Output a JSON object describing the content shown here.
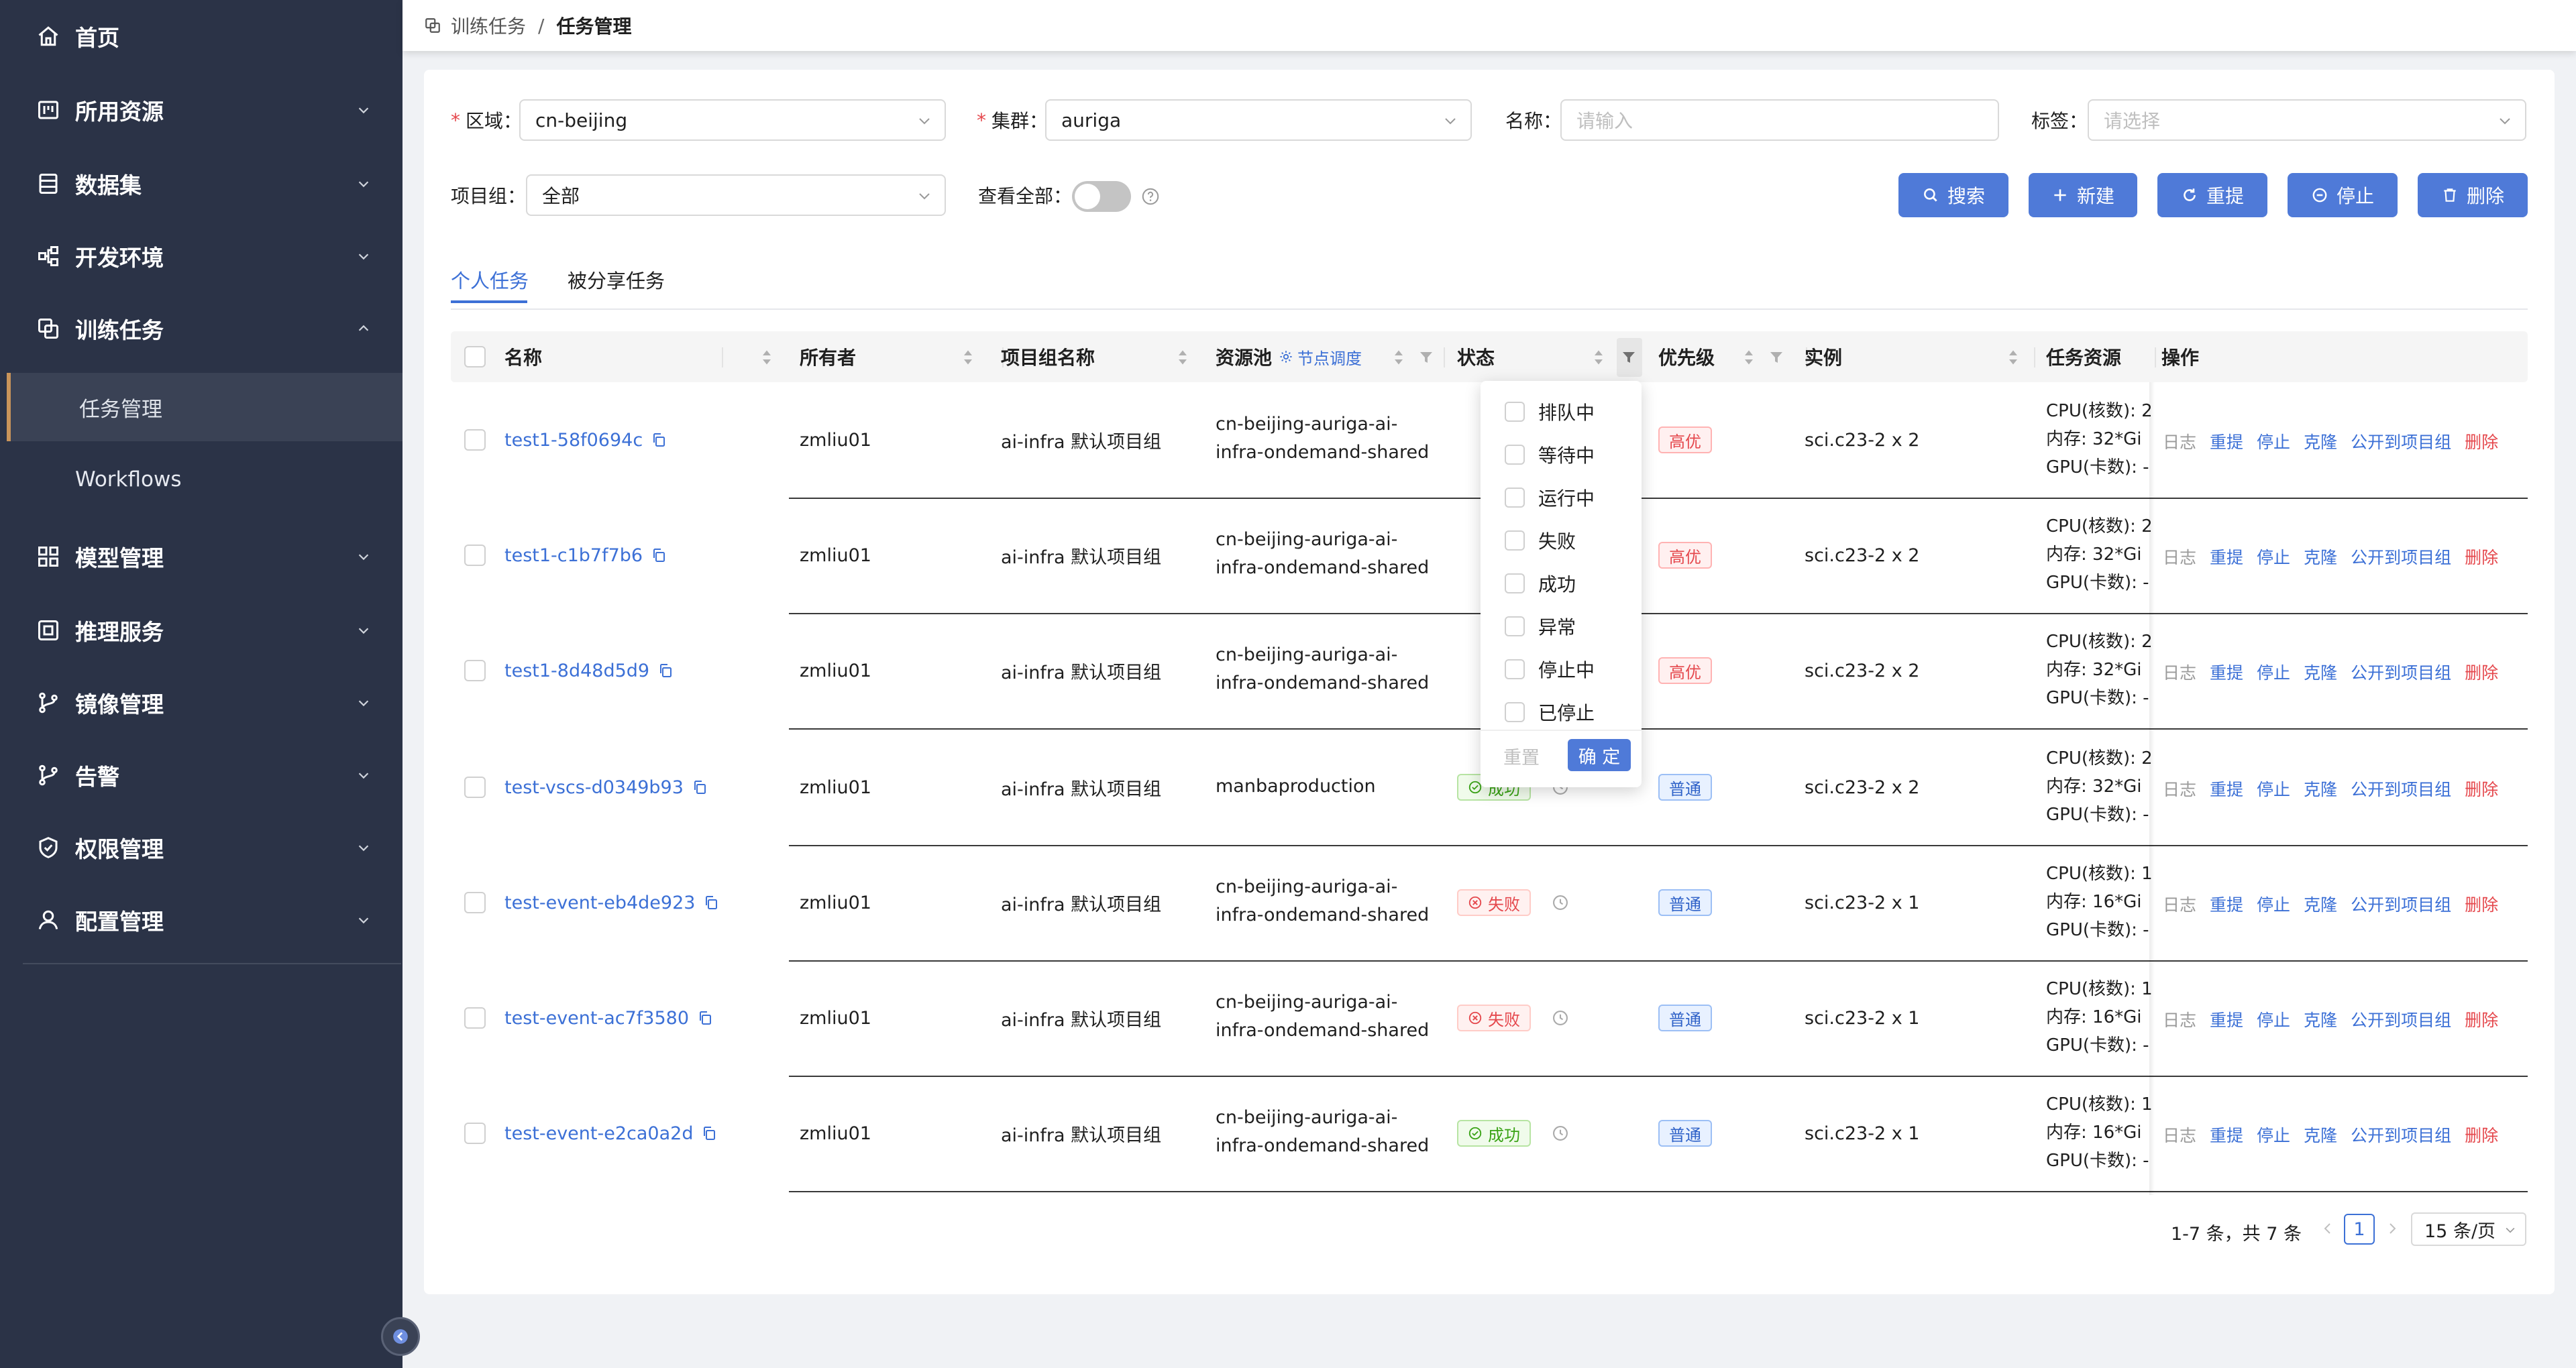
{
  "breadcrumb": {
    "parent": "训练任务",
    "current": "任务管理"
  },
  "sidebar": {
    "items": [
      {
        "label": "首页",
        "icon": "home-icon",
        "has_chevron": false
      },
      {
        "label": "所用资源",
        "icon": "resource-icon",
        "has_chevron": true
      },
      {
        "label": "数据集",
        "icon": "dataset-icon",
        "has_chevron": true
      },
      {
        "label": "开发环境",
        "icon": "dev-env-icon",
        "has_chevron": true
      },
      {
        "label": "训练任务",
        "icon": "training-icon",
        "has_chevron": true,
        "expanded": true
      },
      {
        "label": "模型管理",
        "icon": "model-icon",
        "has_chevron": true
      },
      {
        "label": "推理服务",
        "icon": "inference-icon",
        "has_chevron": true
      },
      {
        "label": "镜像管理",
        "icon": "image-icon",
        "has_chevron": true
      },
      {
        "label": "告警",
        "icon": "alert-icon",
        "has_chevron": true
      },
      {
        "label": "权限管理",
        "icon": "permission-icon",
        "has_chevron": true
      },
      {
        "label": "配置管理",
        "icon": "config-icon",
        "has_chevron": true
      }
    ],
    "subitems": [
      {
        "label": "任务管理",
        "active": true
      },
      {
        "label": "Workflows",
        "active": false
      }
    ]
  },
  "filters": {
    "region_label": "区域：",
    "region_value": "cn-beijing",
    "cluster_label": "集群：",
    "cluster_value": "auriga",
    "name_label": "名称：",
    "name_placeholder": "请输入",
    "tag_label": "标签：",
    "tag_placeholder": "请选择",
    "project_label": "项目组：",
    "project_value": "全部",
    "view_all_label": "查看全部："
  },
  "toolbar": {
    "search": "搜索",
    "create": "新建",
    "resubmit": "重提",
    "stop": "停止",
    "delete": "删除"
  },
  "tabs": [
    {
      "label": "个人任务",
      "active": true
    },
    {
      "label": "被分享任务",
      "active": false
    }
  ],
  "table": {
    "headers": {
      "name": "名称",
      "owner": "所有者",
      "project": "项目组名称",
      "pool": "资源池",
      "pool_link": "节点调度",
      "status": "状态",
      "priority": "优先级",
      "instance": "实例",
      "resource": "任务资源",
      "actions": "操作"
    },
    "actions": [
      "日志",
      "重提",
      "停止",
      "克隆",
      "公开到项目组",
      "删除"
    ],
    "rows": [
      {
        "name": "test1-58f0694c",
        "owner": "zmliu01",
        "project": "ai-infra 默认项目组",
        "pool": [
          "cn-beijing-auriga-ai-",
          "infra-ondemand-shared"
        ],
        "status": "",
        "status_type": "cut",
        "priority": "高优",
        "priority_type": "red",
        "instance": "sci.c23-2 x 2",
        "cpu": "CPU(核数): 2",
        "mem": "内存: 32*Gi",
        "gpu": "GPU(卡数): -"
      },
      {
        "name": "test1-c1b7f7b6",
        "owner": "zmliu01",
        "project": "ai-infra 默认项目组",
        "pool": [
          "cn-beijing-auriga-ai-",
          "infra-ondemand-shared"
        ],
        "status": "",
        "status_type": "cut",
        "priority": "高优",
        "priority_type": "red",
        "instance": "sci.c23-2 x 2",
        "cpu": "CPU(核数): 2",
        "mem": "内存: 32*Gi",
        "gpu": "GPU(卡数): -"
      },
      {
        "name": "test1-8d48d5d9",
        "owner": "zmliu01",
        "project": "ai-infra 默认项目组",
        "pool": [
          "cn-beijing-auriga-ai-",
          "infra-ondemand-shared"
        ],
        "status": "",
        "status_type": "cut",
        "priority": "高优",
        "priority_type": "red",
        "instance": "sci.c23-2 x 2",
        "cpu": "CPU(核数): 2",
        "mem": "内存: 32*Gi",
        "gpu": "GPU(卡数): -"
      },
      {
        "name": "test-vscs-d0349b93",
        "owner": "zmliu01",
        "project": "ai-infra 默认项目组",
        "pool": [
          "manbaproduction"
        ],
        "status": "成功",
        "status_type": "ok",
        "priority": "普通",
        "priority_type": "blue",
        "instance": "sci.c23-2 x 2",
        "cpu": "CPU(核数): 2",
        "mem": "内存: 32*Gi",
        "gpu": "GPU(卡数): -"
      },
      {
        "name": "test-event-eb4de923",
        "owner": "zmliu01",
        "project": "ai-infra 默认项目组",
        "pool": [
          "cn-beijing-auriga-ai-",
          "infra-ondemand-shared"
        ],
        "status": "失败",
        "status_type": "fail",
        "priority": "普通",
        "priority_type": "blue",
        "instance": "sci.c23-2 x 1",
        "cpu": "CPU(核数): 1",
        "mem": "内存: 16*Gi",
        "gpu": "GPU(卡数): -"
      },
      {
        "name": "test-event-ac7f3580",
        "owner": "zmliu01",
        "project": "ai-infra 默认项目组",
        "pool": [
          "cn-beijing-auriga-ai-",
          "infra-ondemand-shared"
        ],
        "status": "失败",
        "status_type": "fail",
        "priority": "普通",
        "priority_type": "blue",
        "instance": "sci.c23-2 x 1",
        "cpu": "CPU(核数): 1",
        "mem": "内存: 16*Gi",
        "gpu": "GPU(卡数): -"
      },
      {
        "name": "test-event-e2ca0a2d",
        "owner": "zmliu01",
        "project": "ai-infra 默认项目组",
        "pool": [
          "cn-beijing-auriga-ai-",
          "infra-ondemand-shared"
        ],
        "status": "成功",
        "status_type": "ok",
        "priority": "普通",
        "priority_type": "blue",
        "instance": "sci.c23-2 x 1",
        "cpu": "CPU(核数): 1",
        "mem": "内存: 16*Gi",
        "gpu": "GPU(卡数): -"
      }
    ]
  },
  "status_filter": {
    "options": [
      "排队中",
      "等待中",
      "运行中",
      "失败",
      "成功",
      "异常",
      "停止中",
      "已停止"
    ],
    "reset": "重置",
    "confirm": "确 定"
  },
  "pagination": {
    "summary": "1-7 条，共 7 条",
    "current_page": "1",
    "page_size": "15 条/页"
  },
  "colors": {
    "sidebar_bg": "#2b3347",
    "primary": "#4f7ad8",
    "link": "#3c70d6",
    "danger": "#e5484d",
    "success": "#3aa316"
  }
}
